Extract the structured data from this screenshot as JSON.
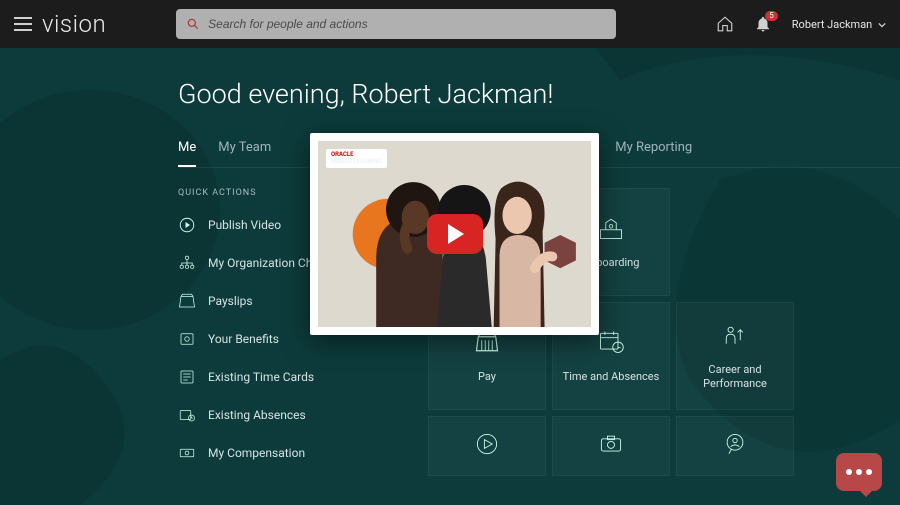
{
  "header": {
    "brand": "vision",
    "search_placeholder": "Search for people and actions",
    "username": "Robert Jackman",
    "notification_count": "5"
  },
  "greeting": "Good evening, Robert Jackman!",
  "tabs": {
    "me": "Me",
    "my_team": "My Team",
    "my_reporting": "My Reporting"
  },
  "quick_actions": {
    "title": "QUICK ACTIONS",
    "items": [
      "Publish Video",
      "My Organization Chart",
      "Payslips",
      "Your Benefits",
      "Existing Time Cards",
      "Existing Absences",
      "My Compensation"
    ]
  },
  "tiles": {
    "row1": {
      "onboarding": "Onboarding"
    },
    "row2": {
      "pay": "Pay",
      "time_absences": "Time and Absences",
      "career_performance": "Career and Performance"
    }
  },
  "modal": {
    "tag_red": "ORACLE",
    "tag_sub": "GUIDED LEARNING"
  }
}
